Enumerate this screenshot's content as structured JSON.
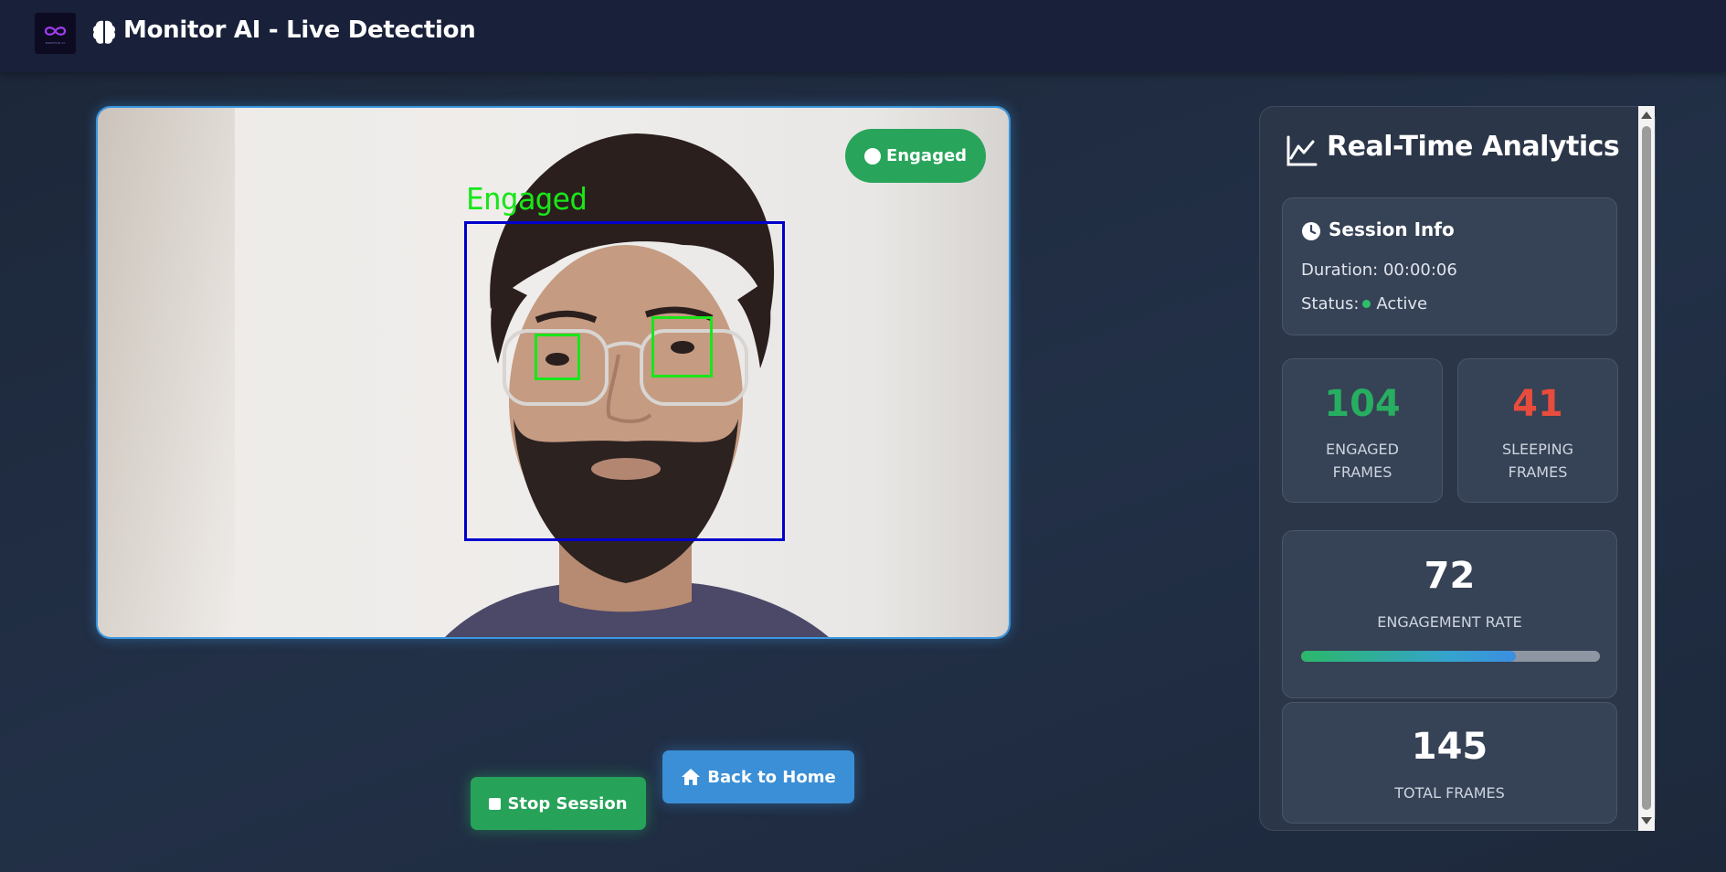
{
  "header": {
    "logo_text": "MONITOR AI",
    "title": "Monitor AI - Live Detection",
    "brain_icon": "brain-icon"
  },
  "video": {
    "status_badge": "Engaged",
    "overlay_label": "Engaged"
  },
  "actions": {
    "stop_label": "Stop Session",
    "home_label": "Back to Home"
  },
  "analytics": {
    "title": "Real-Time Analytics",
    "session": {
      "title": "Session Info",
      "duration_label": "Duration:",
      "duration_value": "00:00:06",
      "status_label": "Status:",
      "status_value": "Active"
    },
    "engaged": {
      "value": "104",
      "label_line1": "ENGAGED",
      "label_line2": "FRAMES",
      "color": "#27ae60"
    },
    "sleeping": {
      "value": "41",
      "label_line1": "SLEEPING",
      "label_line2": "FRAMES",
      "color": "#e74c3c"
    },
    "rate": {
      "value": "72",
      "label": "ENGAGEMENT RATE",
      "fraction": 0.72
    },
    "total": {
      "value": "145",
      "label": "TOTAL FRAMES"
    }
  },
  "colors": {
    "accent_green": "#28a55b",
    "accent_blue": "#3a8fd6",
    "face_box": "#0000cc",
    "eye_box": "#19e619"
  }
}
